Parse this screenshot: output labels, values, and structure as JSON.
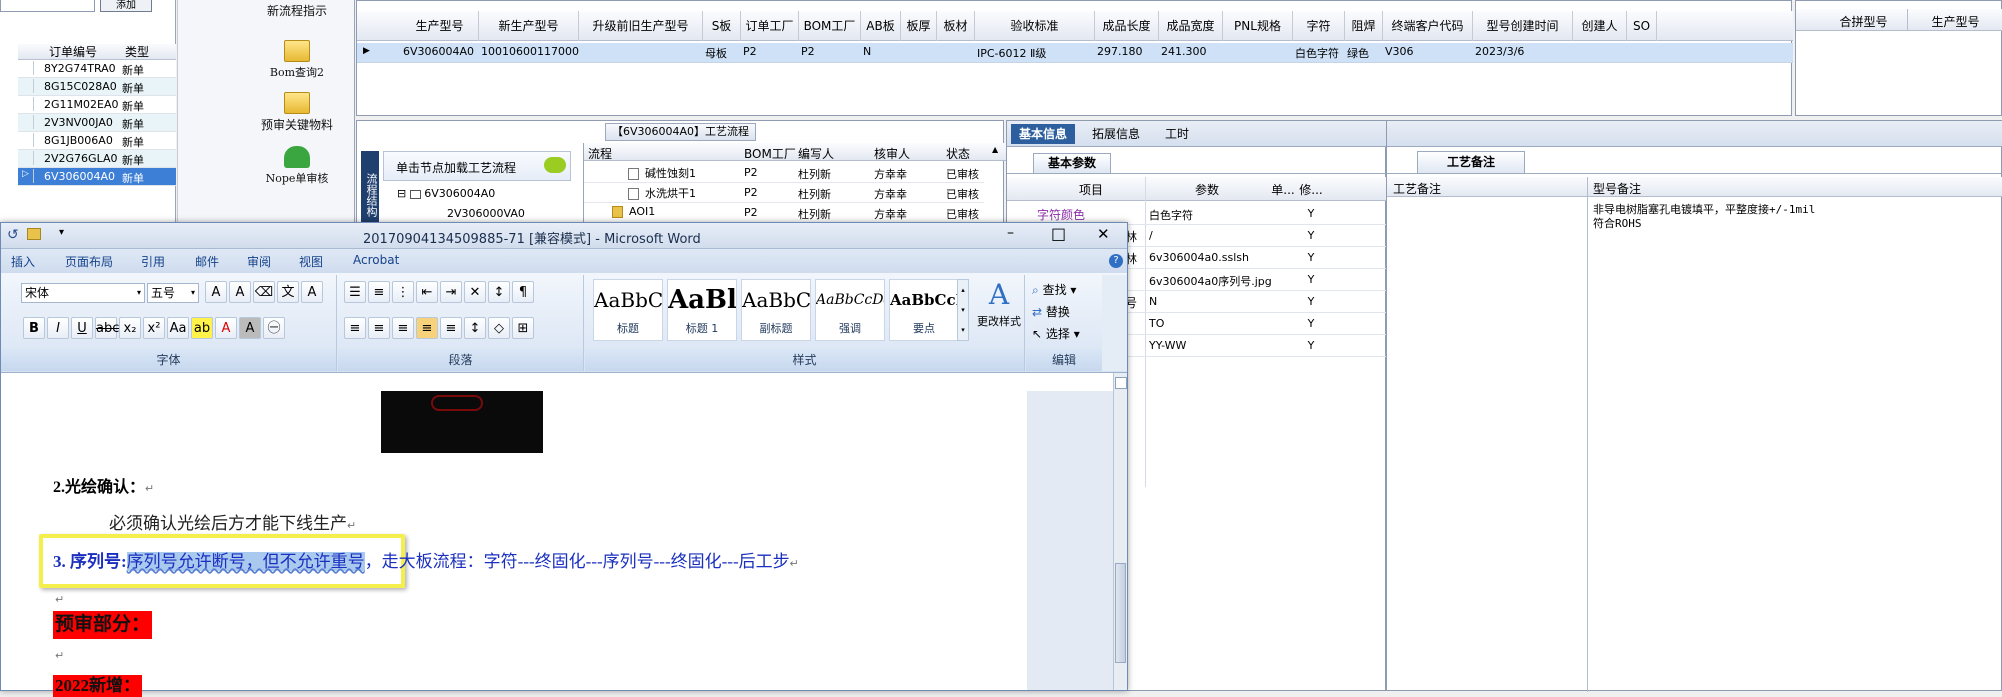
{
  "left_panel": {
    "button_label": "添加",
    "columns": [
      "订单编号",
      "类型"
    ],
    "rows": [
      {
        "id": "8Y2G74TRA0",
        "type": "新单"
      },
      {
        "id": "8G15C028A0",
        "type": "新单"
      },
      {
        "id": "2G11M02EA0",
        "type": "新单"
      },
      {
        "id": "2V3NV00JA0",
        "type": "新单"
      },
      {
        "id": "8G1JB006A0",
        "type": "新单"
      },
      {
        "id": "2V2G76GLA0",
        "type": "新单"
      },
      {
        "id": "6V306004A0",
        "type": "新单"
      }
    ]
  },
  "toolbar": {
    "items": [
      {
        "label": "新流程指示",
        "icon": "document-icon"
      },
      {
        "label": "Bom查询2",
        "icon": "folder-icon"
      },
      {
        "label": "预审关键物料",
        "icon": "folder-icon"
      },
      {
        "label": "Nope单审核",
        "icon": "user-icon"
      }
    ]
  },
  "main_grid": {
    "columns": [
      "生产型号",
      "新生产型号",
      "升级前旧生产型号",
      "S板",
      "订单工厂",
      "BOM工厂",
      "AB板",
      "板厚",
      "板材",
      "验收标准",
      "成品长度",
      "成品宽度",
      "PNL规格",
      "字符",
      "阻焊",
      "终端客户代码",
      "型号创建时间",
      "创建人",
      "SO"
    ],
    "row": [
      "6V306004A0",
      "10010600117000",
      "",
      "母板",
      "P2",
      "P2",
      "N",
      "",
      "",
      "IPC-6012 Ⅱ级",
      "297.180",
      "241.300",
      "",
      "白色字符",
      "绿色",
      "V306",
      "2023/3/6",
      "",
      ""
    ]
  },
  "right_grid": {
    "columns": [
      "合拼型号",
      "生产型号"
    ]
  },
  "process_panel": {
    "title": "【6V306004A0】工艺流程",
    "load_label": "单击节点加载工艺流程",
    "side_tab": "流程结构",
    "tree": [
      "6V306004A0",
      "2V306000VA0"
    ],
    "columns": [
      "流程",
      "BOM工厂",
      "编写人",
      "核审人",
      "状态"
    ],
    "rows": [
      {
        "name": "碱性蚀刻1",
        "factory": "P2",
        "writer": "杜列新",
        "checker": "方幸幸",
        "status": "已审核"
      },
      {
        "name": "水洗烘干1",
        "factory": "P2",
        "writer": "杜列新",
        "checker": "方幸幸",
        "status": "已审核"
      },
      {
        "name": "AOI1",
        "factory": "P2",
        "writer": "杜列新",
        "checker": "方幸幸",
        "status": "已审核"
      }
    ]
  },
  "info_panel": {
    "tabs": [
      "基本信息",
      "拓展信息",
      "工时"
    ],
    "sub_tab": "基本参数",
    "columns": [
      "项目",
      "参数",
      "单...",
      "修..."
    ],
    "rows": [
      {
        "item": "字符颜色",
        "param": "白色字符",
        "flag": "Y"
      },
      {
        "item": "林",
        "param": "/",
        "flag": "Y"
      },
      {
        "item": "林",
        "param": "6v306004a0.sslsh",
        "flag": "Y"
      },
      {
        "item": "",
        "param": "6v306004a0序列号.jpg",
        "flag": "Y"
      },
      {
        "item": "号",
        "param": "N",
        "flag": "Y"
      },
      {
        "item": "",
        "param": "TO",
        "flag": "Y"
      },
      {
        "item": "",
        "param": "YY-WW",
        "flag": "Y"
      }
    ]
  },
  "remark_panel": {
    "tab": "工艺备注",
    "col1": "工艺备注",
    "col2": "型号备注",
    "remark_text_1": "非导电树脂塞孔电镀填平，平整度接+/-1mil",
    "remark_text_2": "符合ROHS"
  },
  "word": {
    "title": "20170904134509885-71 [兼容模式] - Microsoft Word",
    "minimize": "–",
    "maximize": "□",
    "close": "✕",
    "tabs": [
      "插入",
      "页面布局",
      "引用",
      "邮件",
      "审阅",
      "视图",
      "Acrobat"
    ],
    "font_name": "宋体",
    "font_size": "五号",
    "groups": [
      "字体",
      "段落",
      "样式",
      "编辑"
    ],
    "styles": [
      {
        "preview": "AaBbC",
        "label": "标题"
      },
      {
        "preview": "AaBl",
        "label": "标题 1"
      },
      {
        "preview": "AaBbC",
        "label": "副标题"
      },
      {
        "preview": "AaBbCcDd",
        "label": "强调"
      },
      {
        "preview": "AaBbCcD",
        "label": "要点"
      }
    ],
    "change_styles": "更改样式",
    "editing": [
      "查找",
      "替换",
      "选择"
    ],
    "doc": {
      "heading2": "2.光绘确认：",
      "line2": "必须确认光绘后方才能下线生产",
      "h3_prefix": "3. 序列号:",
      "h3_highlight": "序列号允许断号，但不允许重号",
      "h3_rest": "，走大板流程：字符---终固化---序列号---终固化---后工步",
      "red_heading": "预审部分：",
      "red_heading2": "2022新增："
    }
  }
}
